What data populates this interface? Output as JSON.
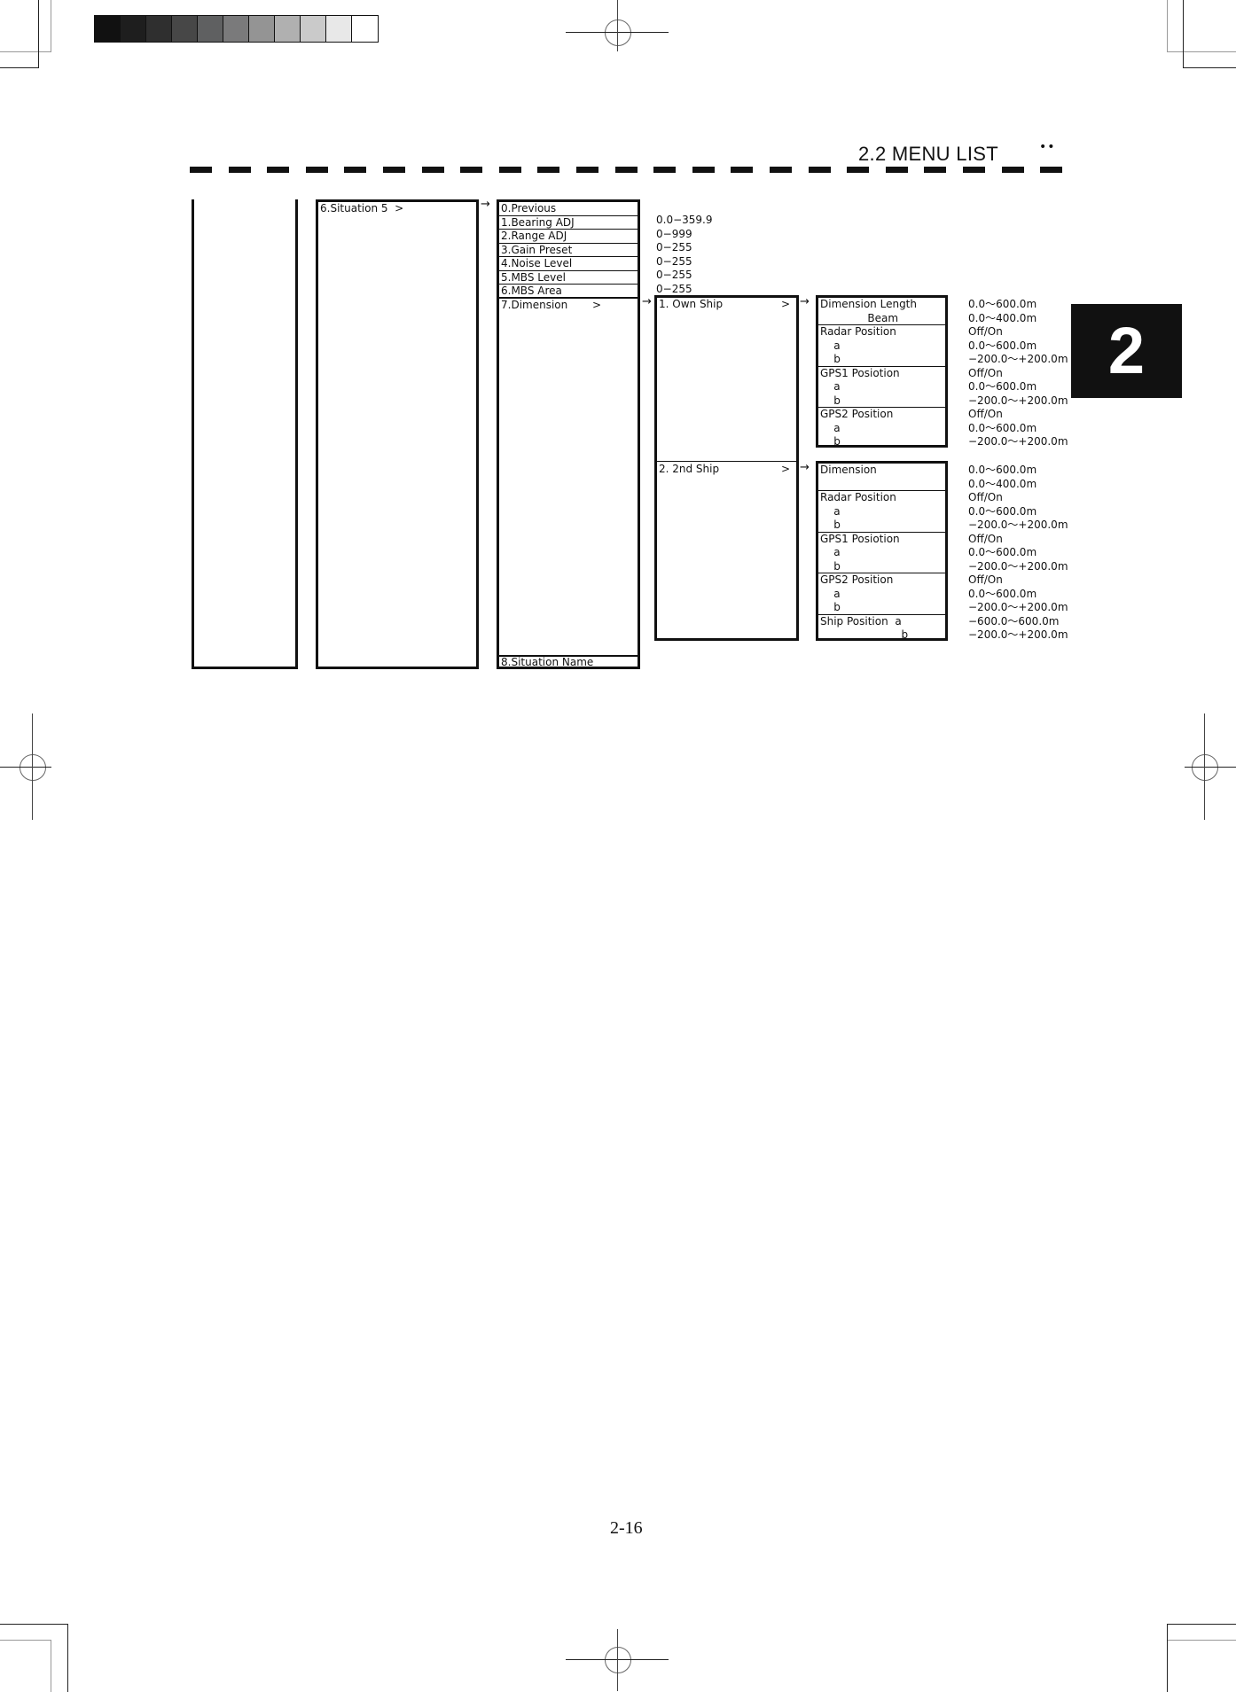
{
  "header": {
    "section_title": "2.2 MENU LIST",
    "dots": "••"
  },
  "chapter_tab": "2",
  "page_number": "2-16",
  "gray_scale_swatches": [
    "#111111",
    "#1e1e1e",
    "#2f2f2f",
    "#474747",
    "#5f6061",
    "#7a7a7b",
    "#949494",
    "#b0b0b0",
    "#cacaca",
    "#e8e8e8",
    "#ffffff"
  ],
  "menu": {
    "level2": {
      "label": "6.Situation 5  >"
    },
    "level3": {
      "items": [
        {
          "label": "0.Previous",
          "range": ""
        },
        {
          "label": "1.Bearing ADJ",
          "range": "0.0−359.9"
        },
        {
          "label": "2.Range ADJ",
          "range": "0−999"
        },
        {
          "label": "3.Gain Preset",
          "range": "0−255"
        },
        {
          "label": "4.Noise Level",
          "range": "0−255"
        },
        {
          "label": "5.MBS Level",
          "range": "0−255"
        },
        {
          "label": "6.MBS Area",
          "range": "0−255"
        },
        {
          "label": "7.Dimension",
          "chevron": ">"
        },
        {
          "label": "8.Situation Name"
        }
      ]
    },
    "level4": {
      "own_ship": {
        "label": "1. Own Ship",
        "chevron": ">"
      },
      "second_ship": {
        "label": "2. 2nd Ship",
        "chevron": ">"
      }
    },
    "own_ship_detail": [
      {
        "lines": [
          "Dimension Length",
          "              Beam"
        ],
        "ranges": [
          "0.0〜600.0m",
          "0.0〜400.0m"
        ]
      },
      {
        "lines": [
          "Radar Position",
          "    a",
          "    b"
        ],
        "ranges": [
          "Off/On",
          "0.0〜600.0m",
          "−200.0〜+200.0m"
        ]
      },
      {
        "lines": [
          "GPS1 Posiotion",
          "    a",
          "    b"
        ],
        "ranges": [
          "Off/On",
          "0.0〜600.0m",
          "−200.0〜+200.0m"
        ]
      },
      {
        "lines": [
          "GPS2 Position",
          "    a",
          "    b"
        ],
        "ranges": [
          "Off/On",
          "0.0〜600.0m",
          "−200.0〜+200.0m"
        ]
      }
    ],
    "second_ship_detail": [
      {
        "lines": [
          "Dimension",
          ""
        ],
        "ranges": [
          "0.0〜600.0m",
          "0.0〜400.0m"
        ]
      },
      {
        "lines": [
          "Radar Position",
          "    a",
          "    b"
        ],
        "ranges": [
          "Off/On",
          "0.0〜600.0m",
          "−200.0〜+200.0m"
        ]
      },
      {
        "lines": [
          "GPS1 Posiotion",
          "    a",
          "    b"
        ],
        "ranges": [
          "Off/On",
          "0.0〜600.0m",
          "−200.0〜+200.0m"
        ]
      },
      {
        "lines": [
          "GPS2 Position",
          "    a",
          "    b"
        ],
        "ranges": [
          "Off/On",
          "0.0〜600.0m",
          "−200.0〜+200.0m"
        ]
      },
      {
        "lines": [
          "Ship Position  a",
          "                        b"
        ],
        "ranges": [
          "−600.0〜600.0m",
          "−200.0〜+200.0m"
        ]
      }
    ],
    "arrow": "→"
  }
}
